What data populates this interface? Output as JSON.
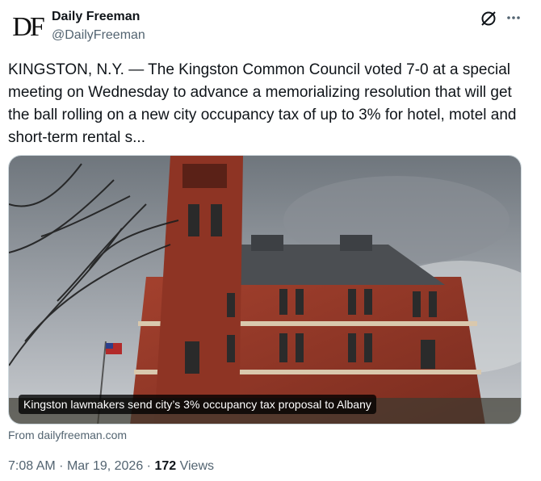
{
  "account": {
    "avatar_text": "DF",
    "name": "Daily Freeman",
    "handle": "@DailyFreeman"
  },
  "icons": {
    "grok": "grok-icon",
    "more": "more-icon"
  },
  "tweet": {
    "text": "KINGSTON, N.Y. — The Kingston Common Council voted 7-0 at a special meeting on Wednesday to advance a memorializing resolution that will get the ball rolling on a new city occupancy tax of up to 3% for hotel, motel and short-term rental s..."
  },
  "card": {
    "image": "red-brick-city-hall-with-clock-tower",
    "caption": "Kingston lawmakers send city’s 3% occupancy tax proposal to Albany",
    "source": "From dailyfreeman.com"
  },
  "meta": {
    "time": "7:08 AM",
    "separator": "·",
    "date": "Mar 19, 2026",
    "views_count": "172",
    "views_label": "Views"
  }
}
